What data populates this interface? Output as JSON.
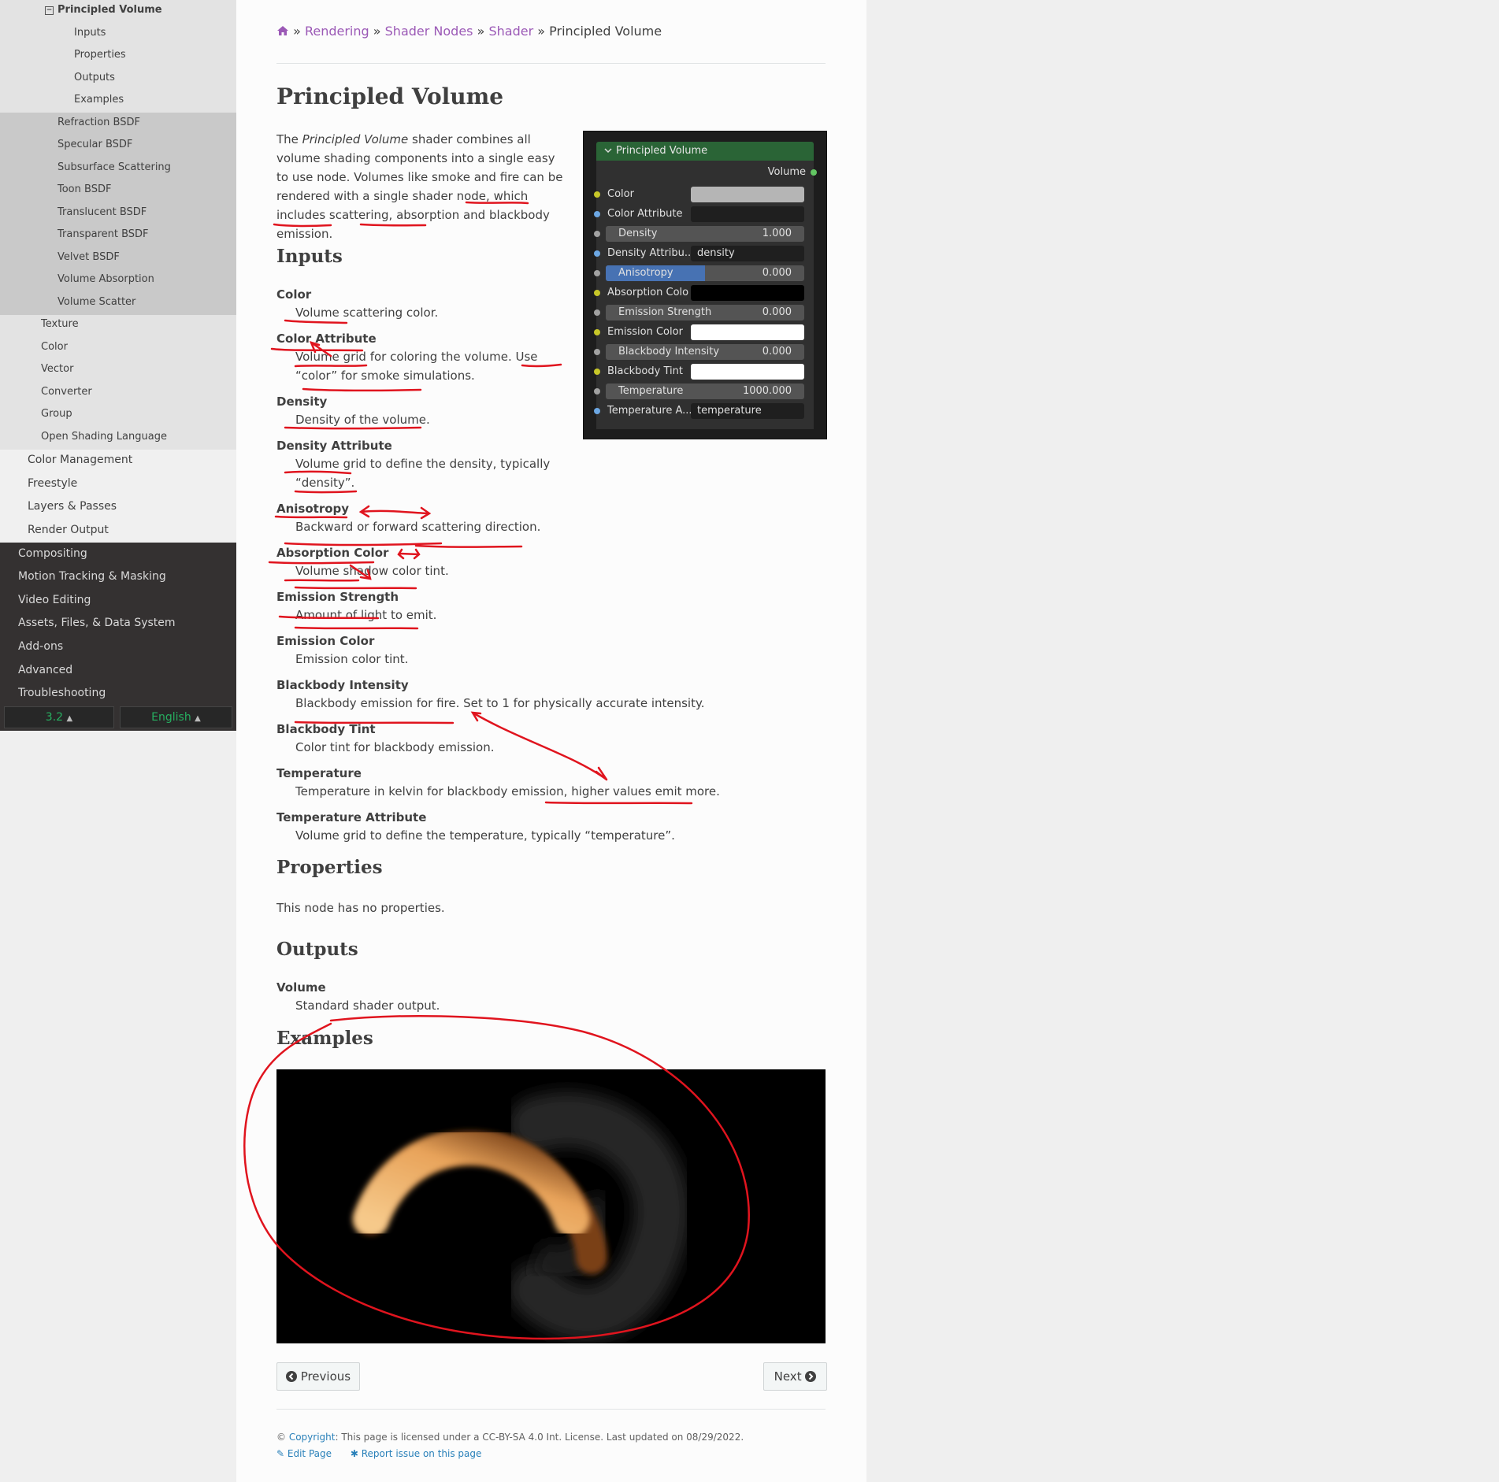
{
  "sidebar": {
    "current": "Principled Volume",
    "current_children": [
      "Inputs",
      "Properties",
      "Outputs",
      "Examples"
    ],
    "shader_items": [
      "Refraction BSDF",
      "Specular BSDF",
      "Subsurface Scattering",
      "Toon BSDF",
      "Translucent BSDF",
      "Transparent BSDF",
      "Velvet BSDF",
      "Volume Absorption",
      "Volume Scatter"
    ],
    "node_categories": [
      "Texture",
      "Color",
      "Vector",
      "Converter",
      "Group",
      "Open Shading Language"
    ],
    "rendering_items": [
      "Color Management",
      "Freestyle",
      "Layers & Passes",
      "Render Output"
    ],
    "top_items": [
      "Compositing",
      "Motion Tracking & Masking",
      "Video Editing",
      "Assets, Files, & Data System",
      "Add-ons",
      "Advanced",
      "Troubleshooting"
    ],
    "version": "3.2",
    "language": "English"
  },
  "breadcrumb": {
    "items": [
      "Rendering",
      "Shader Nodes",
      "Shader"
    ],
    "current": "Principled Volume"
  },
  "page_title": "Principled Volume",
  "intro": {
    "pre": "The ",
    "emph": "Principled Volume",
    "post": " shader combines all volume shading components into a single easy to use node. Volumes like smoke and fire can be rendered with a single shader node, which includes scattering, absorption and blackbody emission."
  },
  "sections": {
    "inputs": "Inputs",
    "properties": "Properties",
    "outputs": "Outputs",
    "examples": "Examples"
  },
  "inputs": [
    {
      "term": "Color",
      "def": "Volume scattering color."
    },
    {
      "term": "Color Attribute",
      "def": "Volume grid for coloring the volume. Use “color” for smoke simulations."
    },
    {
      "term": "Density",
      "def": "Density of the volume."
    },
    {
      "term": "Density Attribute",
      "def": "Volume grid to define the density, typically “density”."
    },
    {
      "term": "Anisotropy",
      "def": "Backward or forward scattering direction."
    },
    {
      "term": "Absorption Color",
      "def": "Volume shadow color tint."
    },
    {
      "term": "Emission Strength",
      "def": "Amount of light to emit."
    },
    {
      "term": "Emission Color",
      "def": "Emission color tint."
    },
    {
      "term": "Blackbody Intensity",
      "def": "Blackbody emission for fire. Set to 1 for physically accurate intensity."
    },
    {
      "term": "Blackbody Tint",
      "def": "Color tint for blackbody emission."
    },
    {
      "term": "Temperature",
      "def": "Temperature in kelvin for blackbody emission, higher values emit more."
    },
    {
      "term": "Temperature Attribute",
      "def": "Volume grid to define the temperature, typically “temperature”."
    }
  ],
  "properties_text": "This node has no properties.",
  "outputs": [
    {
      "term": "Volume",
      "def": "Standard shader output."
    }
  ],
  "node": {
    "title": "Principled Volume",
    "output": "Volume",
    "color": "Color",
    "color_attr": "Color Attribute",
    "density_label": "Density",
    "density_value": "1.000",
    "density_attr": "Density Attribu...",
    "density_attr_value": "density",
    "anisotropy_label": "Anisotropy",
    "anisotropy_value": "0.000",
    "absorption": "Absorption Colo",
    "emission_strength_label": "Emission Strength",
    "emission_strength_value": "0.000",
    "emission_color": "Emission Color",
    "blackbody_label": "Blackbody Intensity",
    "blackbody_value": "0.000",
    "blackbody_tint": "Blackbody Tint",
    "temperature_label": "Temperature",
    "temperature_value": "1000.000",
    "temperature_attr": "Temperature A...",
    "temperature_attr_value": "temperature"
  },
  "nav": {
    "previous": "Previous",
    "next": "Next"
  },
  "footer": {
    "copyright_link": "Copyright",
    "license": ": This page is licensed under a CC-BY-SA 4.0 Int. License. Last updated on 08/29/2022.",
    "edit": "Edit Page",
    "report": "Report issue on this page"
  },
  "colors": {
    "link": "#9b59b6",
    "node_header": "#2a6436",
    "annotation": "#e0141e",
    "sidebar_dark": "#343131"
  }
}
